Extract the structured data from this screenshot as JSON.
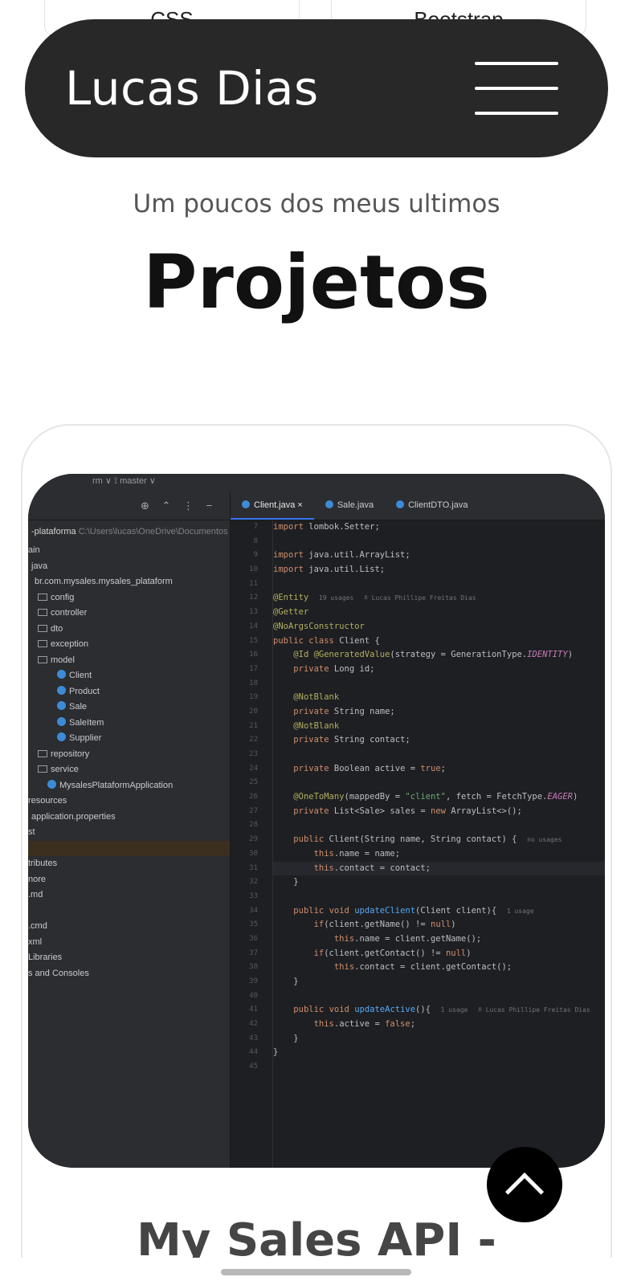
{
  "peek_cards": [
    "CSS",
    "Bootstrap"
  ],
  "navbar": {
    "brand": "Lucas Dias",
    "menu_icon": "hamburger-icon"
  },
  "section": {
    "subtitle": "Um poucos dos meus ultimos",
    "title": "Projetos"
  },
  "project": {
    "title": "My Sales API -",
    "screenshot": {
      "top_bar": "rm ∨   ⟟ master ∨",
      "project_name": "-plataforma",
      "project_path": "C:\\Users\\lucas\\OneDrive\\Documentos",
      "tabs": [
        "Client.java",
        "Sale.java",
        "ClientDTO.java"
      ],
      "tree": [
        "ain",
        "java",
        "br.com.mysales.mysales_plataform",
        "config",
        "controller",
        "dto",
        "exception",
        "model",
        "Client",
        "Product",
        "Sale",
        "SaleItem",
        "Supplier",
        "repository",
        "service",
        "MysalesPlataformApplication",
        "resources",
        "application.properties",
        "st",
        "",
        "tributes",
        "nore",
        ".md",
        "",
        ".cmd",
        "xml",
        "Libraries",
        "s and Consoles"
      ],
      "line_numbers": [
        "7",
        "8",
        "9",
        "10",
        "11",
        "12",
        "13",
        "14",
        "15",
        "16",
        "17",
        "18",
        "19",
        "20",
        "21",
        "22",
        "23",
        "24",
        "25",
        "26",
        "27",
        "28",
        "29",
        "30",
        "31",
        "32",
        "33",
        "34",
        "35",
        "36",
        "37",
        "38",
        "39",
        "40",
        "41",
        "42",
        "43",
        "44",
        "45"
      ],
      "code": [
        "import lombok.Setter;",
        "",
        "import java.util.ArrayList;",
        "import java.util.List;",
        "",
        "@Entity  19 usages  ≗ Lucas Phillipe Freitas Dias",
        "@Getter",
        "@NoArgsConstructor",
        "public class Client {",
        "    @Id @GeneratedValue(strategy = GenerationType.IDENTITY)",
        "    private Long id;",
        "",
        "    @NotBlank",
        "    private String name;",
        "    @NotBlank",
        "    private String contact;",
        "",
        "    private Boolean active = true;",
        "",
        "    @OneToMany(mappedBy = \"client\", fetch = FetchType.EAGER)",
        "    private List<Sale> sales = new ArrayList<>();",
        "",
        "    public Client(String name, String contact) {  no usages",
        "        this.name = name;",
        "        this.contact = contact;",
        "    }",
        "",
        "    public void updateClient(Client client){  1 usage",
        "        if(client.getName() != null)",
        "            this.name = client.getName();",
        "        if(client.getContact() != null)",
        "            this.contact = client.getContact();",
        "    }",
        "",
        "    public void updateActive(){  1 usage  ≗ Lucas Phillipe Freitas Dias",
        "        this.active = false;",
        "    }",
        "}",
        ""
      ]
    }
  },
  "scroll_top_icon": "chevron-up-icon"
}
